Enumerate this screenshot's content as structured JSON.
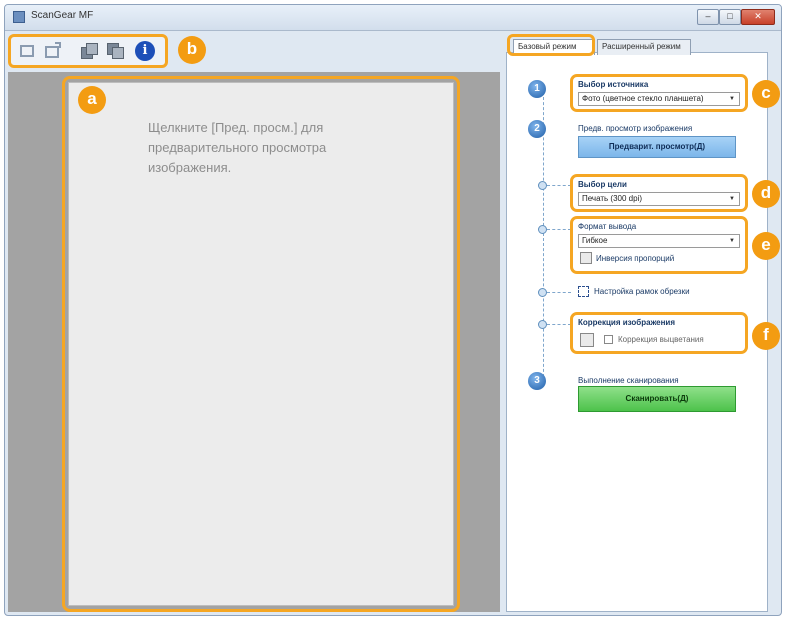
{
  "window": {
    "title": "ScanGear MF",
    "minimize": "–",
    "maximize": "□",
    "close": "✕"
  },
  "callouts": [
    "a",
    "b",
    "c",
    "d",
    "e",
    "f"
  ],
  "toolbar": {
    "icons": [
      "crop-icon",
      "rotate-icon",
      "copy-icon",
      "paste-icon",
      "info-icon"
    ],
    "info": "i"
  },
  "preview": {
    "hint": "Щелкните [Пред. просм.] для предварительного просмотра изображения."
  },
  "tabs": {
    "simple": "Базовый режим",
    "advanced": "Расширенный режим"
  },
  "steps": {
    "step1": "1",
    "step2": "2",
    "step3": "3"
  },
  "source": {
    "label": "Выбор источника",
    "value": "Фото (цветное стекло планшета)"
  },
  "preview_step": {
    "label": "Предв. просмотр изображения",
    "button": "Предварит. просмотр(Д)"
  },
  "destination": {
    "label": "Выбор цели",
    "value": "Печать (300 dpi)"
  },
  "output_size": {
    "label": "Формат вывода",
    "value": "Гибкое",
    "invert_label": "Инверсия пропорций"
  },
  "crop": {
    "label": "Настройка рамок обрезки"
  },
  "correction": {
    "label": "Коррекция изображения",
    "checkbox_label": "Коррекция выцветания"
  },
  "scan": {
    "label": "Выполнение сканирования",
    "button": "Сканировать(Д)"
  },
  "colors": {
    "callout": "#f39c12",
    "scan_button": "#4dc24b",
    "preview_button": "#7cb6ea"
  }
}
